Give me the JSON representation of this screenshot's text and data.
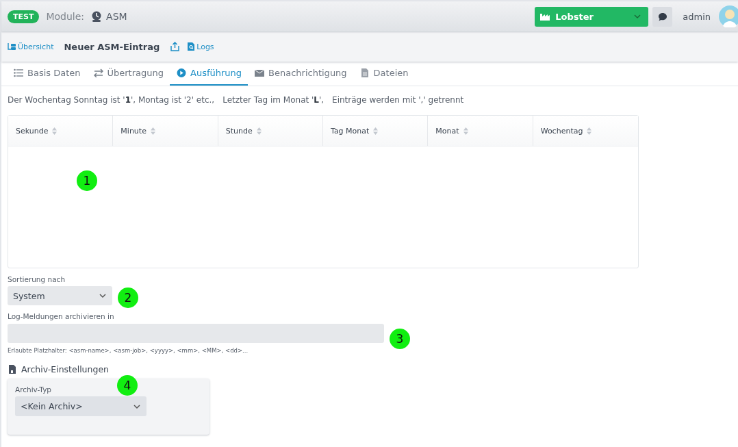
{
  "header": {
    "env_badge": "TEST",
    "module_label": "Module:",
    "module_name": "ASM",
    "company_select": "Lobster",
    "user": "admin"
  },
  "toolbar": {
    "overview_link": "Übersicht",
    "title": "Neuer ASM-Eintrag",
    "logs_link": "Logs"
  },
  "tabs": [
    {
      "label": "Basis Daten",
      "selected": false
    },
    {
      "label": "Übertragung",
      "selected": false
    },
    {
      "label": "Ausführung",
      "selected": true
    },
    {
      "label": "Benachrichtigung",
      "selected": false
    },
    {
      "label": "Dateien",
      "selected": false
    }
  ],
  "hints": [
    "Der Wochentag Sonntag ist '**1**', Montag ist '2' etc.,",
    "Letzter Tag im Monat '**L**',",
    "Einträge werden mit ',' getrennt"
  ],
  "table": {
    "columns": [
      "Sekunde",
      "Minute",
      "Stunde",
      "Tag Monat",
      "Monat",
      "Wochentag"
    ]
  },
  "sort": {
    "label": "Sortierung nach",
    "value": "System"
  },
  "archive_path": {
    "label": "Log-Meldungen archivieren in",
    "help": "Erlaubte Platzhalter: <asm-name>, <asm-job>, <yyyy>, <mm>, <MM>, <dd>..."
  },
  "archive_settings": {
    "heading": "Archiv-Einstellungen",
    "type_label": "Archiv-Typ",
    "type_value": "<Kein Archiv>"
  },
  "markers": [
    "1",
    "2",
    "3",
    "4"
  ]
}
